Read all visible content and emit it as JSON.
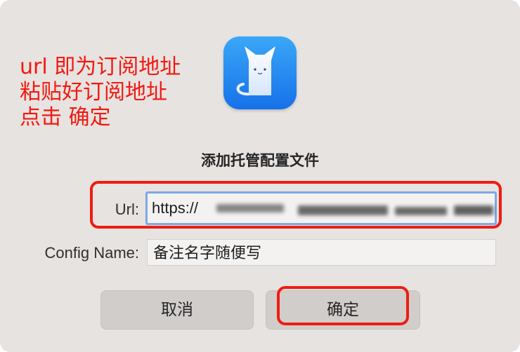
{
  "annotation": {
    "lines": [
      "url 即为订阅地址",
      "粘贴好订阅地址",
      "点击 确定"
    ],
    "color": "#f2190f"
  },
  "app_icon": {
    "icon": "white-cat-icon",
    "bg_color": "#2388f0"
  },
  "dialog": {
    "title": "添加托管配置文件",
    "url_label": "Url:",
    "url_value": "https://",
    "config_name_label": "Config Name:",
    "config_name_value": "备注名字随便写",
    "cancel_label": "取消",
    "ok_label": "确定"
  },
  "highlight_color": "#ef1c12"
}
